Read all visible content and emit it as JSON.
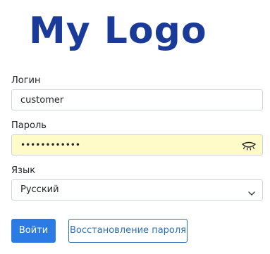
{
  "logo": {
    "text": "My Logo"
  },
  "login": {
    "label": "Логин",
    "value": "customer"
  },
  "password": {
    "label": "Пароль",
    "value": "••••••••••••",
    "toggle_icon": "eye-closed-icon"
  },
  "language": {
    "label": "Язык",
    "selected": "Русский",
    "icon": "chevron-down-icon"
  },
  "buttons": {
    "login": "Войти",
    "recover": "Восстановление пароля"
  },
  "colors": {
    "logo": "#1a3a9a",
    "primary": "#2c7be5",
    "outline": "#2c6fb8",
    "autofill": "#fffbc8"
  }
}
